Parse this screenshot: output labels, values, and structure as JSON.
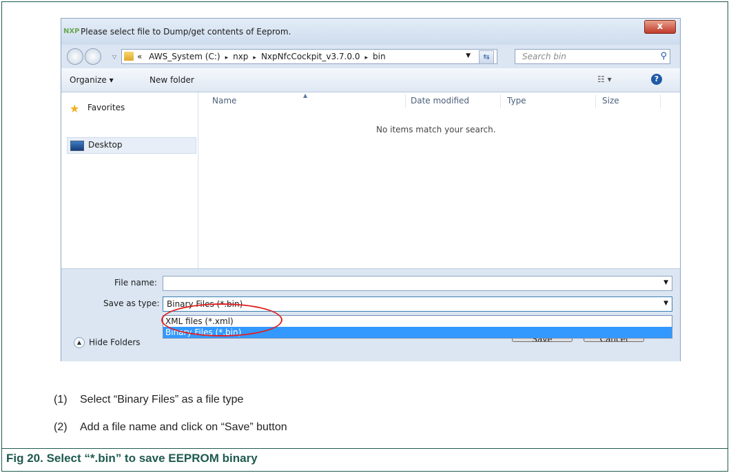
{
  "dialog": {
    "logo": "NXP",
    "title": "Please select file to Dump/get contents of Eeprom.",
    "close": "x",
    "address": {
      "prefix": "«",
      "crumbs": [
        "AWS_System (C:)",
        "nxp",
        "NxpNfcCockpit_v3.7.0.0",
        "bin"
      ],
      "separator": "▸"
    },
    "search_placeholder": "Search bin",
    "toolbar": {
      "organize": "Organize ▾",
      "new_folder": "New folder",
      "view": "☷ ▾",
      "help": "?"
    },
    "sidebar": [
      {
        "label": "Favorites",
        "icon": "star-icon"
      },
      {
        "label": "Desktop",
        "icon": "desktop-icon"
      }
    ],
    "columns": [
      "Name",
      "Date modified",
      "Type",
      "Size"
    ],
    "empty_message": "No items match your search.",
    "file_name_label": "File name:",
    "file_name_value": "",
    "save_type_label": "Save as type:",
    "save_type_value": "Binary Files (*.bin)",
    "save_type_options": [
      "XML files (*.xml)",
      "Binary Files (*.bin)"
    ],
    "highlighted_option": 1,
    "hide_folders": "Hide Folders",
    "save_button": "Save",
    "cancel_button": "Cancel"
  },
  "steps": [
    {
      "num": "(1)",
      "text": "Select “Binary Files” as a file type"
    },
    {
      "num": "(2)",
      "text": "Add a file name and click on “Save” button"
    }
  ],
  "caption": "Fig 20.   Select “*.bin” to save EEPROM binary",
  "colors": {
    "frame": "#1e5a4e",
    "highlight": "#3399ff",
    "annotation": "#e02020"
  }
}
